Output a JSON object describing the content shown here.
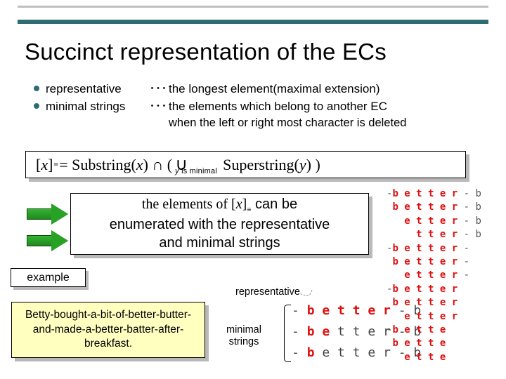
{
  "title": "Succinct representation of the ECs",
  "bullet1": {
    "label": "representative",
    "dots": "･･･",
    "desc": "the longest element(maximal extension)"
  },
  "bullet2": {
    "label": "minimal strings",
    "dots": "･･･",
    "desc": "the elements which belong to another EC"
  },
  "bullet2b": "when the left or right most character is deleted",
  "formula": {
    "lhs_open": "[",
    "lhs_var": "x",
    "lhs_close": "]",
    "eq": " = Substring( ",
    "x2": "x",
    "mid": " ) ∩ ( ",
    "union": "∪",
    "union_sub1": "y",
    "union_sub2": " is minimal",
    "tail1": "Superstring( ",
    "y": "y",
    "tail2": " ) )"
  },
  "enumerate": {
    "l1a": "the elements of [",
    "l1b": "x",
    "l1c": "]",
    "l1d": " can be",
    "l2": "enumerated with the representative",
    "l3": "and minimal strings"
  },
  "example_label": "example",
  "sentence": "Betty-bought-a-bit-of-better-butter-and-made-a-better-batter-after-breakfast.",
  "labels": {
    "representative": "representative",
    "minimal": "minimal",
    "strings": "strings"
  },
  "center_block": [
    "- <b>b e t t e r</b> - b",
    "- <b>b e</b> t t e r - b",
    "- <b>b</b> e t t e r - b"
  ],
  "right_ladder": [
    "-<b>b e t t e r</b> - b",
    " <b>b e t t e r</b> - b",
    "   <b>e t t e r</b> - b",
    "     <b>t t e r</b> - b",
    "-<b>b e t t e r</b> -",
    " <b>b e t t e r</b> -",
    "   <b>e t t e r</b> -",
    "-<b>b e t t e r</b>",
    " <b>b e t t e r</b>",
    "   <b>e t t e r</b>",
    "-<b>b e t t e</b>",
    " <b>b e t t e</b>",
    "   <b>e t t e</b>"
  ]
}
